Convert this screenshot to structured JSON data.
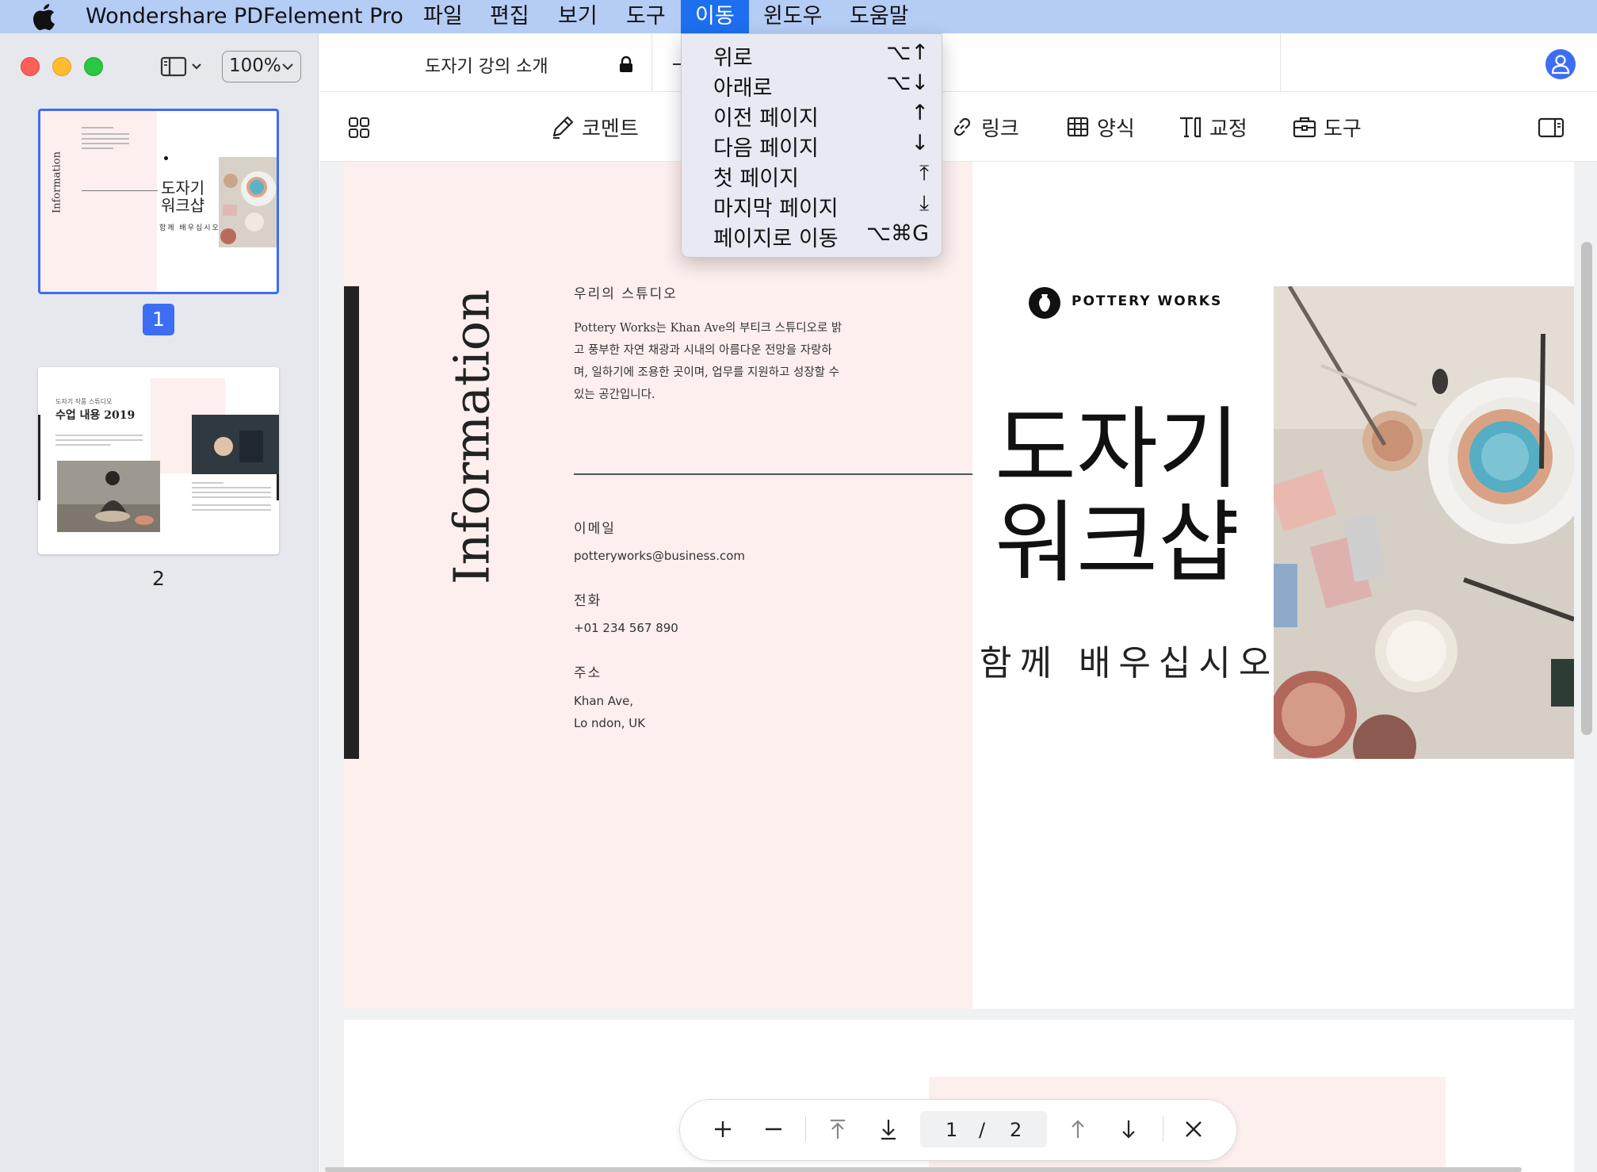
{
  "menubar": {
    "app_name": "Wondershare PDFelement Pro",
    "items": [
      {
        "label": "파일"
      },
      {
        "label": "편집"
      },
      {
        "label": "보기"
      },
      {
        "label": "도구"
      },
      {
        "label": "이동"
      },
      {
        "label": "윈도우"
      },
      {
        "label": "도움말"
      }
    ],
    "active_item": "이동"
  },
  "sidebar": {
    "zoom": "100%",
    "pages": [
      {
        "number": "1",
        "selected": true
      },
      {
        "number": "2",
        "selected": false
      }
    ],
    "thumb1": {
      "vertical": "Information",
      "title": "도자기 워크샵",
      "subtitle": "함께 배우십시오"
    },
    "thumb2": {
      "small": "도자기 작품 스튜디오",
      "title": "수업 내용 2019"
    }
  },
  "tab": {
    "title": "도자기 강의 소개"
  },
  "toolbar": {
    "items": [
      {
        "label": "코멘트",
        "icon": "pen-icon"
      },
      {
        "label": "링크",
        "icon": "link-icon"
      },
      {
        "label": "양식",
        "icon": "table-icon"
      },
      {
        "label": "교정",
        "icon": "redact-icon"
      },
      {
        "label": "도구",
        "icon": "toolbox-icon"
      }
    ]
  },
  "menu_dropdown": {
    "items": [
      {
        "label": "위로",
        "shortcut": "⌥↑"
      },
      {
        "label": "아래로",
        "shortcut": "⌥↓"
      },
      {
        "label": "이전 페이지",
        "shortcut": "↑"
      },
      {
        "label": "다음 페이지",
        "shortcut": "↓"
      },
      {
        "label": "첫 페이지",
        "shortcut": "⤒"
      },
      {
        "label": "마지막 페이지",
        "shortcut": "⤓"
      },
      {
        "label": "페이지로 이동",
        "shortcut": "⌥⌘G"
      }
    ]
  },
  "document": {
    "vertical_title": "Information",
    "studio_heading": "우리의 스튜디오",
    "studio_text": "Pottery Works는 Khan Ave의 부티크 스튜디오로 밝고 풍부한 자연 채광과 시내의 아름다운 전망을 자랑하며, 일하기에 조용한 곳이며, 업무를 지원하고 성장할 수있는 공간입니다.",
    "email_label": "이메일",
    "email": "potteryworks@business.com",
    "phone_label": "전화",
    "phone": "+01 234 567 890",
    "address_label": "주소",
    "address_line1": "Khan Ave,",
    "address_line2": "Lo ndon, UK",
    "brand": "POTTERY WORKS",
    "title_line1": "도자기",
    "title_line2": "워크샵",
    "subtitle": "함께 배우십시오"
  },
  "nav": {
    "current_page": "1",
    "separator": "/",
    "total_pages": "2"
  },
  "colors": {
    "accent": "#3d6df5",
    "menubar": "#b5ccf5",
    "menu_active": "#1d6ff0",
    "pink": "#fdefee"
  }
}
